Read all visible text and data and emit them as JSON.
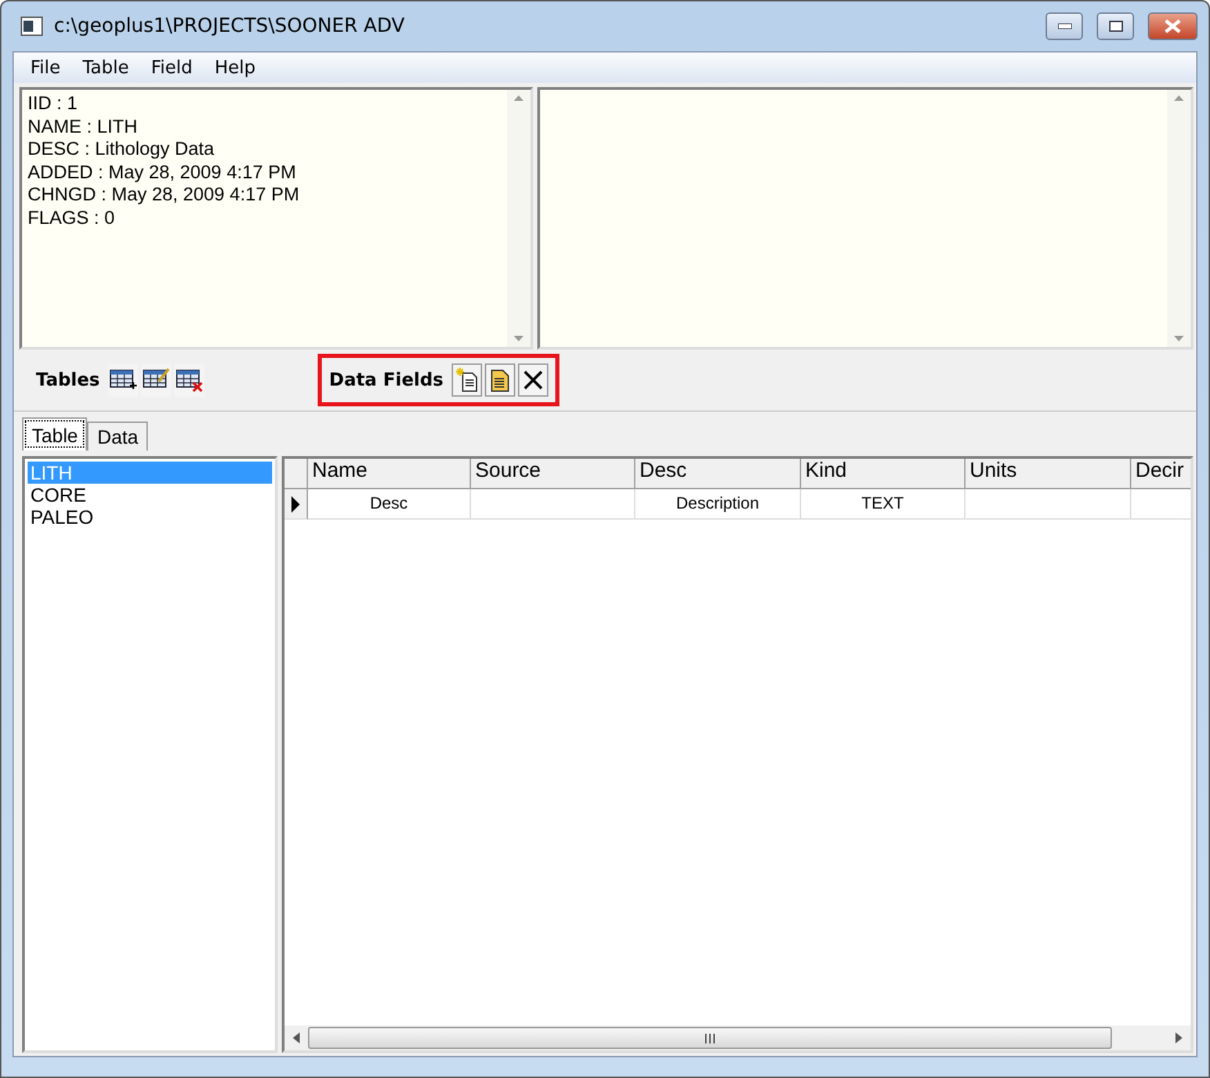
{
  "window": {
    "title": "c:\\geoplus1\\PROJECTS\\SOONER ADV"
  },
  "menu": [
    "File",
    "Table",
    "Field",
    "Help"
  ],
  "info_pane": {
    "lines": [
      "IID : 1",
      "NAME : LITH",
      "DESC : Lithology Data",
      "ADDED : May 28, 2009 4:17 PM",
      "CHNGD : May 28, 2009 4:17 PM",
      "FLAGS : 0"
    ]
  },
  "tables_toolbar": {
    "label": "Tables"
  },
  "data_fields_toolbar": {
    "label": "Data Fields",
    "highlighted": true
  },
  "tabs": [
    {
      "label": "Table",
      "selected": true
    },
    {
      "label": "Data",
      "selected": false
    }
  ],
  "table_list": [
    {
      "label": "LITH",
      "selected": true
    },
    {
      "label": "CORE",
      "selected": false
    },
    {
      "label": "PALEO",
      "selected": false
    }
  ],
  "grid": {
    "columns": [
      "Name",
      "Source",
      "Desc",
      "Kind",
      "Units",
      "Decir"
    ],
    "rows": [
      {
        "current": true,
        "cells": [
          "Desc",
          "",
          "Description",
          "TEXT",
          "",
          ""
        ]
      }
    ]
  }
}
